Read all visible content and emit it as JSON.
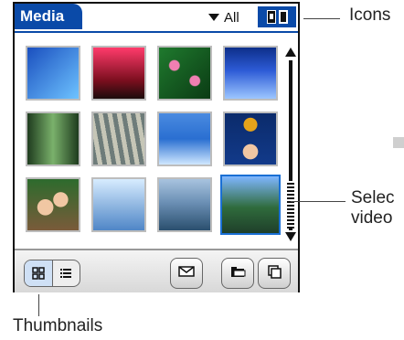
{
  "app": {
    "title": "Media",
    "filter_label": "All"
  },
  "icons": {
    "filter_dropdown": "triangle-down-icon",
    "view_icons": [
      "thumbnail-view-icon",
      "list-view-icon"
    ],
    "bottom_view_toggle": [
      "thumbnail-grid-icon",
      "list-icon"
    ],
    "actions": [
      "mail-icon",
      "folder-icon",
      "copy-icon"
    ]
  },
  "thumbnails": [
    {
      "name": "thumb-blue-abstract",
      "colors": [
        "#1a4fbf",
        "#6ec3ff"
      ]
    },
    {
      "name": "thumb-sunset",
      "colors": [
        "#ff3b6b",
        "#1b0c0c"
      ]
    },
    {
      "name": "thumb-lilypads",
      "colors": [
        "#1f7a2e",
        "#f07fb2"
      ]
    },
    {
      "name": "thumb-ice",
      "colors": [
        "#0d2f8a",
        "#9cc6ff"
      ]
    },
    {
      "name": "thumb-forest",
      "colors": [
        "#1e3b1e",
        "#7ab16b"
      ]
    },
    {
      "name": "thumb-tree-bark",
      "colors": [
        "#6e7c7a",
        "#c6c6b7"
      ]
    },
    {
      "name": "thumb-beach",
      "colors": [
        "#2a6fd1",
        "#cfe7ff"
      ]
    },
    {
      "name": "thumb-ball",
      "colors": [
        "#0b2b6b",
        "#e5a31a"
      ]
    },
    {
      "name": "thumb-people",
      "colors": [
        "#2d6b2d",
        "#f1c7a3"
      ]
    },
    {
      "name": "thumb-sea-horizon",
      "colors": [
        "#8bb3df",
        "#d7ecff"
      ]
    },
    {
      "name": "thumb-lake",
      "colors": [
        "#6c90b5",
        "#2a4f6e"
      ]
    },
    {
      "name": "thumb-hills-video",
      "colors": [
        "#2f6b3c",
        "#7fb6ff"
      ]
    }
  ],
  "annotations": {
    "icons_label": "Icons",
    "thumbnails_label": "Thumbnails",
    "selected_line1": "Selec",
    "selected_line2": "video"
  }
}
